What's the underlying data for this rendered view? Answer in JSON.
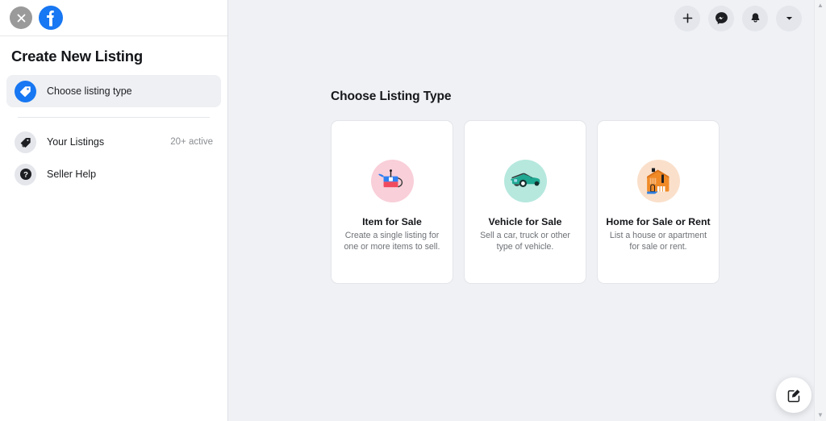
{
  "sidebar": {
    "close_icon": "close-icon",
    "brand_icon": "facebook-logo",
    "title": "Create New Listing",
    "items": [
      {
        "label": "Choose listing type",
        "icon": "price-tag-icon",
        "active": true,
        "badge": ""
      },
      {
        "label": "Your Listings",
        "icon": "tag-icon",
        "active": false,
        "badge": "20+ active"
      },
      {
        "label": "Seller Help",
        "icon": "question-mark-icon",
        "active": false,
        "badge": ""
      }
    ]
  },
  "header": {
    "buttons": [
      {
        "name": "create-button",
        "icon": "plus-icon"
      },
      {
        "name": "messenger-button",
        "icon": "messenger-icon"
      },
      {
        "name": "notifications-button",
        "icon": "bell-icon"
      },
      {
        "name": "account-menu-button",
        "icon": "chevron-down-icon"
      }
    ]
  },
  "main": {
    "title": "Choose Listing Type",
    "cards": [
      {
        "title": "Item for Sale",
        "description": "Create a single listing for one or more items to sell.",
        "icon": "teapot-icon",
        "icon_bg": "#f9cfd9"
      },
      {
        "title": "Vehicle for Sale",
        "description": "Sell a car, truck or other type of vehicle.",
        "icon": "car-icon",
        "icon_bg": "#b6e8de"
      },
      {
        "title": "Home for Sale or Rent",
        "description": "List a house or apartment for sale or rent.",
        "icon": "house-icon",
        "icon_bg": "#fae0cb"
      }
    ]
  },
  "fab": {
    "icon": "compose-icon"
  },
  "scrollbar": {
    "up_arrow": "▲",
    "down_arrow": "▼"
  },
  "colors": {
    "brand_blue": "#1877f2",
    "page_bg": "#eff1f5",
    "card_bg": "#ffffff",
    "teapot_blue": "#2d7ff2",
    "teapot_red": "#f04a5e",
    "car_teal": "#1fa892",
    "house_orange": "#f08a27"
  }
}
